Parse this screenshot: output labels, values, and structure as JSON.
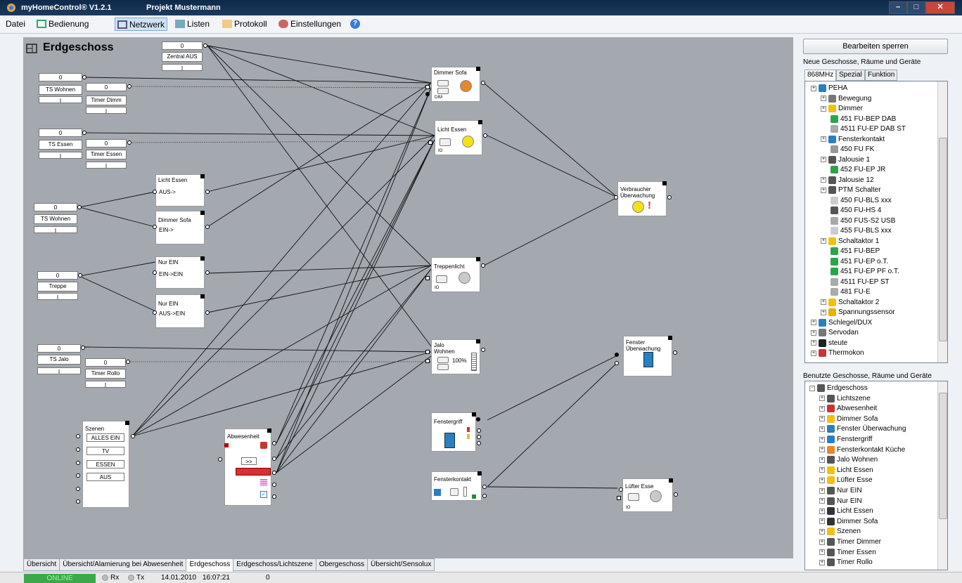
{
  "app": {
    "title": "myHomeControl® V1.2.1",
    "project": "Projekt Mustermann"
  },
  "menu": {
    "items": [
      "Datei",
      "Bedienung",
      "Netzwerk",
      "Listen",
      "Protokoll",
      "Einstellungen"
    ],
    "selected": "Netzwerk"
  },
  "canvas": {
    "title": "Erdgeschoss"
  },
  "nodes": {
    "zentral_aus": {
      "o": "0",
      "label": "Zentral AUS",
      "i": "I"
    },
    "ts_wohnen1": {
      "o": "0",
      "label": "TS Wohnen",
      "i": "I"
    },
    "timer_dimm": {
      "o": "0",
      "label": "Timer Dimm",
      "i": "I"
    },
    "ts_essen": {
      "o": "0",
      "label": "TS Essen",
      "i": "I"
    },
    "timer_essen": {
      "o": "0",
      "label": "Timer Essen",
      "i": "I"
    },
    "ts_wohnen2": {
      "o": "0",
      "label": "TS Wohnen",
      "i": "I"
    },
    "treppe": {
      "o": "0",
      "label": "Treppe",
      "i": "I"
    },
    "ts_jalo": {
      "o": "0",
      "label": "TS Jalo",
      "i": "I"
    },
    "timer_rollo": {
      "o": "0",
      "label": "Timer Rollo",
      "i": "I"
    },
    "licht_essen_sc": {
      "title": "Licht Essen",
      "sub": "AUS->"
    },
    "dimmer_sofa_sc": {
      "title": "Dimmer Sofa",
      "sub": "EIN->"
    },
    "nur_ein1": {
      "title": "Nur EIN",
      "sub": "EIN->EIN"
    },
    "nur_ein2": {
      "title": "Nur EIN",
      "sub": "AUS->EIN"
    },
    "dimmer_sofa": {
      "title": "Dimmer Sofa",
      "sub": "DIM"
    },
    "licht_essen": {
      "title": "Licht Essen",
      "sub": "IO"
    },
    "treppenlicht": {
      "title": "Treppenlicht",
      "sub": "IO"
    },
    "jalo_wohnen": {
      "title": "Jalo Wohnen",
      "pct": "100%"
    },
    "verbraucher": {
      "title": "Verbraucher Überwachung"
    },
    "fenster_uew": {
      "title": "Fenster Überwachung"
    },
    "fenstergriff": {
      "title": "Fenstergriff"
    },
    "fensterkontakt": {
      "title": "Fensterkontakt"
    },
    "luefter": {
      "title": "Lüfter Esse",
      "sub": "IO"
    },
    "szenen": {
      "title": "Szenen",
      "buttons": [
        "ALLES EIN",
        "TV",
        "ESSEN",
        "AUS"
      ]
    },
    "abwesenheit": {
      "title": "Abwesenheit",
      "btn": ">>"
    }
  },
  "tabs": [
    "Übersicht",
    "Übersicht/Alamierung bei Abwesenheit",
    "Erdgeschoss",
    "Erdgeschoss/Lichtszene",
    "Obergeschoss",
    "Übersicht/Sensolux"
  ],
  "active_tab": "Erdgeschoss",
  "status": {
    "online": "ONLINE",
    "rx": "Rx",
    "tx": "Tx",
    "date": "14.01.2010",
    "time": "16:07:21",
    "count": "0"
  },
  "right": {
    "lock_button": "Bearbeiten sperren",
    "new_label": "Neue Geschosse, Räume und Geräte",
    "rtabs": [
      "868MHz",
      "Spezial",
      "Funktion"
    ],
    "used_label": "Benutzte Geschosse, Räume und Geräte",
    "tree1": [
      "PEHA",
      "Bewegung",
      "Dimmer",
      "451 FU-BEP DAB",
      "4511 FU-EP DAB ST",
      "Fensterkontakt",
      "450 FU FK",
      "Jalousie 1",
      "452 FU-EP JR",
      "Jalousie 12",
      "PTM Schalter",
      "450 FU-BLS xxx",
      "450 FU-HS 4",
      "450 FUS-S2 USB",
      "455 FU-BLS xxx",
      "Schaltaktor 1",
      "451 FU-BEP",
      "451 FU-EP o.T.",
      "451 FU-EP PF o.T.",
      "4511 FU-EP ST",
      "481 FU-E",
      "Schaltaktor 2",
      "Spannungssensor",
      "Schlegel/DUX",
      "Servodan",
      "steute",
      "Thermokon"
    ],
    "tree2": [
      "Erdgeschoss",
      "Lichtszene",
      "Abwesenheit",
      "Dimmer Sofa",
      "Fenster Überwachung",
      "Fenstergriff",
      "Fensterkontakt Küche",
      "Jalo Wohnen",
      "Licht Essen",
      "Lüfter Esse",
      "Nur EIN",
      "Nur EIN",
      "Licht Essen",
      "Dimmer Sofa",
      "Szenen",
      "Timer Dimmer",
      "Timer Essen",
      "Timer Rollo"
    ]
  },
  "colors": {
    "online": "#3da84b",
    "canvas": "#a4a9b0",
    "lamp_orange": "#e8862a",
    "lamp_yellow": "#f2e21a",
    "abw_red": "#d83030"
  }
}
